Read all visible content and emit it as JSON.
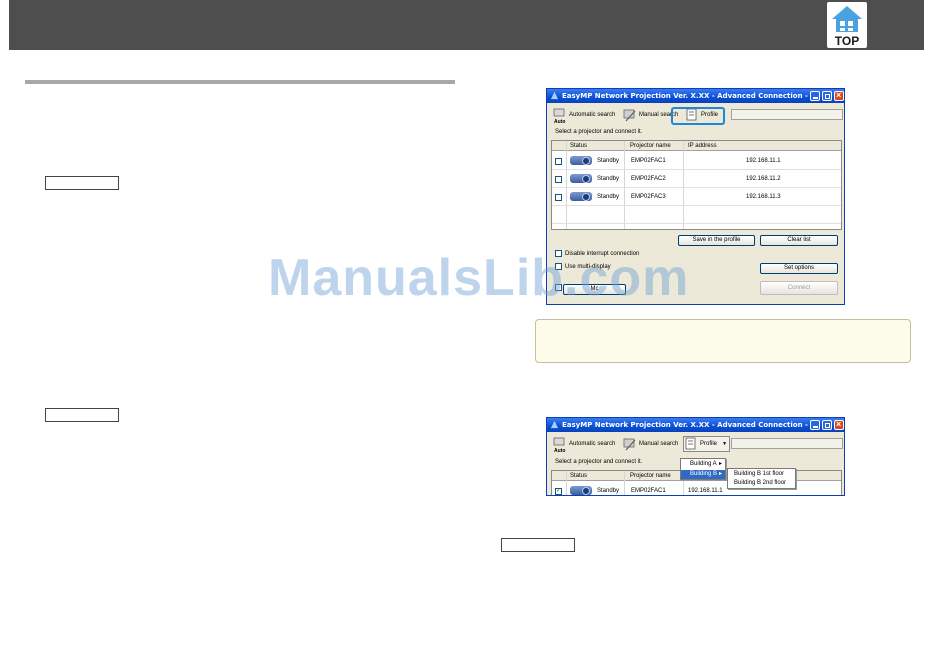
{
  "header": {
    "top_button_label": "TOP"
  },
  "watermark": "ManualsLib.com",
  "window1": {
    "title": "EasyMP Network Projection Ver. X.XX - Advanced Connection -",
    "toolbar": {
      "auto_label": "Automatic search",
      "auto_caption": "Auto",
      "manual_label": "Manual search",
      "profile_label": "Profile"
    },
    "hint": "Select a projector and connect it.",
    "columns": [
      "Status",
      "Projector name",
      "IP address"
    ],
    "rows": [
      {
        "status": "Standby",
        "name": "EMP02FAC1",
        "ip": "192.168.11.1",
        "checked": false
      },
      {
        "status": "Standby",
        "name": "EMP02FAC2",
        "ip": "192.168.11.2",
        "checked": false
      },
      {
        "status": "Standby",
        "name": "EMP02FAC3",
        "ip": "192.168.11.3",
        "checked": false
      }
    ],
    "save_profile_label": "Save in the profile",
    "clear_list_label": "Clear list",
    "disable_interrupt_label": "Disable interrupt connection",
    "use_multi_label": "Use multi-display",
    "set_options_label": "Set options",
    "connect_label": "Connect",
    "bottom_button_label": "Mc"
  },
  "window2": {
    "title": "EasyMP Network Projection Ver. X.XX - Advanced Connection -",
    "toolbar": {
      "auto_label": "Automatic search",
      "auto_caption": "Auto",
      "manual_label": "Manual search",
      "profile_label": "Profile"
    },
    "hint": "Select a projector and connect it.",
    "columns": [
      "Status",
      "Projector name"
    ],
    "rows": [
      {
        "status": "Standby",
        "name": "EMP02FAC1",
        "ip": "192.168.11.1",
        "checked": true
      }
    ],
    "menu": [
      "Building A",
      "Building B"
    ],
    "submenu": [
      "Building B 1st floor",
      "Building B 2nd floor"
    ]
  },
  "colors": {
    "header_bar": "#4e4e4e",
    "highlight": "#1e88d6",
    "title_blue": "#0a4fd6",
    "menu_select": "#316ac5"
  }
}
